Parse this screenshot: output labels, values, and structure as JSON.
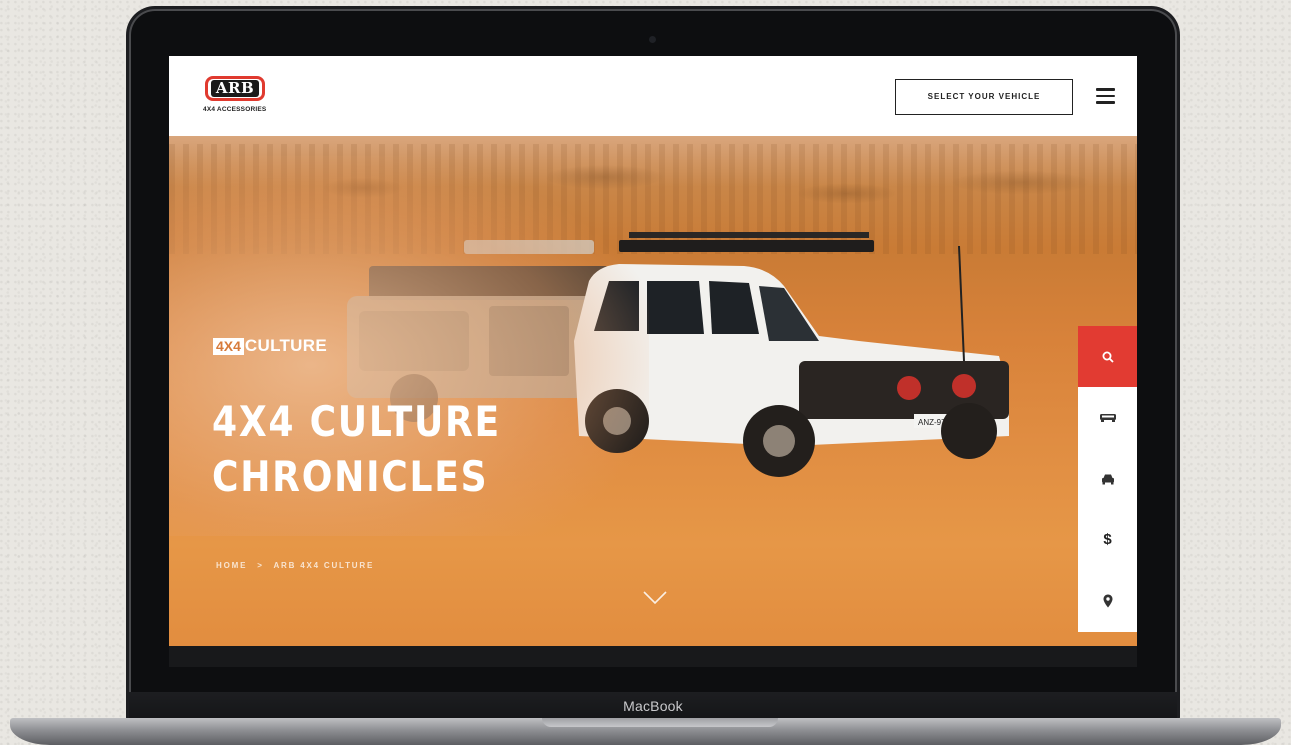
{
  "device": {
    "brand_label": "MacBook"
  },
  "header": {
    "logo_text": "ARB",
    "logo_subtitle": "4X4 ACCESSORIES",
    "select_vehicle_label": "SELECT YOUR VEHICLE"
  },
  "hero": {
    "eyebrow_box": "4X4",
    "eyebrow_text": "CULTURE",
    "title_line1": "4X4 CULTURE",
    "title_line2": "CHRONICLES",
    "breadcrumb": {
      "home": "HOME",
      "separator": ">",
      "current": "ARB 4X4 CULTURE"
    },
    "plate_text": "ANZ-979"
  },
  "side_toolbar": {
    "items": [
      {
        "icon": "search-icon",
        "active": true
      },
      {
        "icon": "vehicle-accessory-icon"
      },
      {
        "icon": "car-icon"
      },
      {
        "icon": "dollar-icon",
        "glyph": "$"
      },
      {
        "icon": "location-pin-icon"
      }
    ]
  },
  "colors": {
    "accent_red": "#e23b32",
    "desert_orange": "#e08d42",
    "header_bg": "#ffffff",
    "text_dark": "#222222"
  }
}
